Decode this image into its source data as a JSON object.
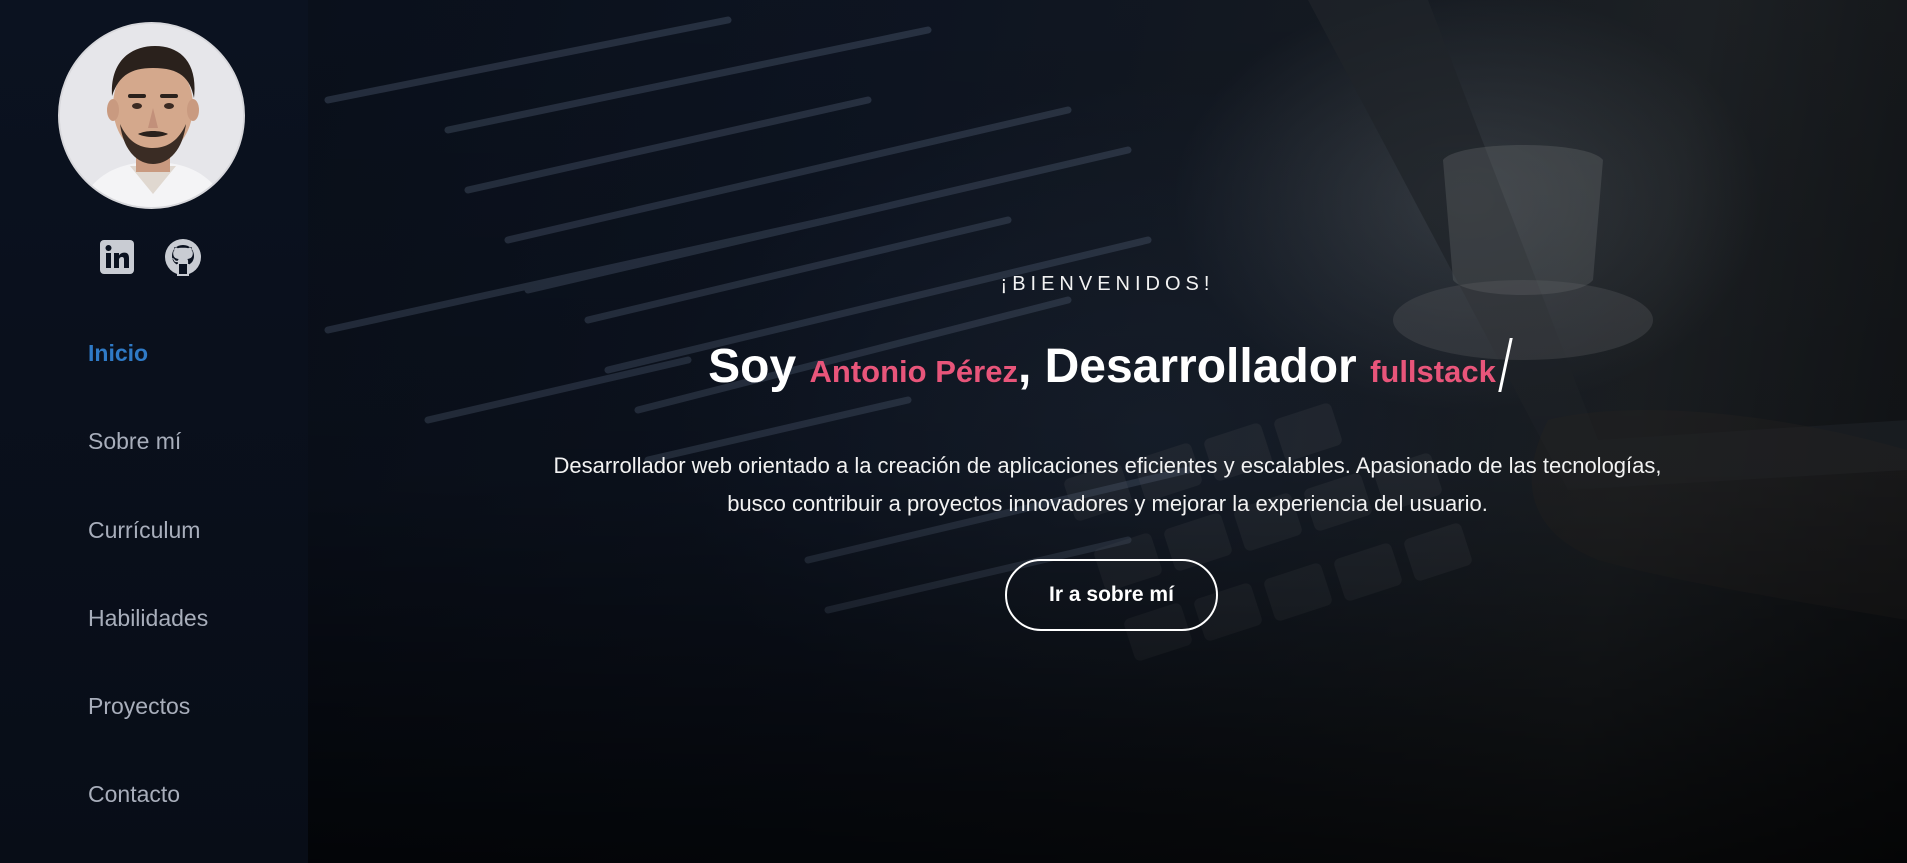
{
  "profile": {
    "avatar_alt": "Antonio Pérez",
    "social": [
      {
        "name": "LinkedIn",
        "icon": "linkedin-icon"
      },
      {
        "name": "GitHub",
        "icon": "github-icon"
      }
    ]
  },
  "nav": {
    "items": [
      {
        "label": "Inicio",
        "active": true
      },
      {
        "label": "Sobre mí",
        "active": false
      },
      {
        "label": "Currículum",
        "active": false
      },
      {
        "label": "Habilidades",
        "active": false
      },
      {
        "label": "Proyectos",
        "active": false
      },
      {
        "label": "Contacto",
        "active": false
      }
    ]
  },
  "hero": {
    "welcome": "¡BIENVENIDOS!",
    "headline_prefix": "Soy ",
    "name": "Antonio Pérez",
    "headline_middle": ", Desarrollador ",
    "role": "fullstack",
    "description_line1": "Desarrollador web orientado a la creación de aplicaciones eficientes y escalables. Apasionado de las tecnologías,",
    "description_line2": "busco contribuir a proyectos innovadores y mejorar la experiencia del usuario.",
    "cta_label": "Ir a sobre mí"
  },
  "colors": {
    "accent": "#e8557a",
    "nav_active": "#2f7ac6",
    "nav_text": "#a8aebb",
    "sidebar_bg": "#0b1220"
  }
}
